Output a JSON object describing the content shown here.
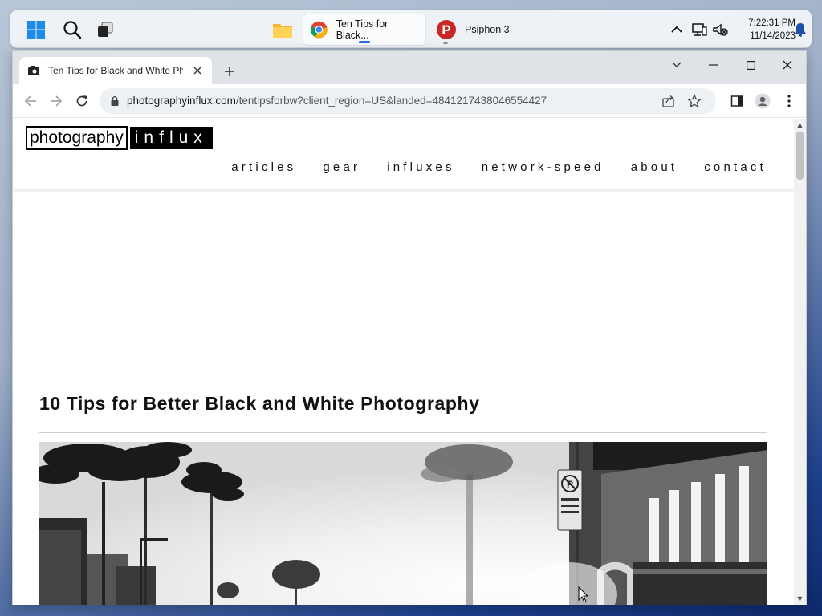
{
  "taskbar": {
    "apps": [
      {
        "label": "Ten Tips for Black...",
        "icon": "chrome-icon"
      },
      {
        "label": "Psiphon 3",
        "icon": "psiphon-icon"
      }
    ],
    "clock": {
      "time": "7:22:31 PM",
      "date": "11/14/2023"
    }
  },
  "browser": {
    "tab_title": "Ten Tips for Black and White Pho",
    "url_host": "photographyinflux.com",
    "url_path": "/tentipsforbw?client_region=US&landed=4841217438046554427"
  },
  "site": {
    "logo_part1": "photography",
    "logo_part2": "influx",
    "nav": [
      "articles",
      "gear",
      "influxes",
      "network-speed",
      "about",
      "contact"
    ]
  },
  "article": {
    "title": "10 Tips for Better Black and White Photography"
  },
  "colors": {
    "accent": "#2b6fd6",
    "chrome_red": "#db4437",
    "chrome_green": "#0f9d58",
    "chrome_yellow": "#f4b400",
    "psiphon": "#c62828"
  }
}
